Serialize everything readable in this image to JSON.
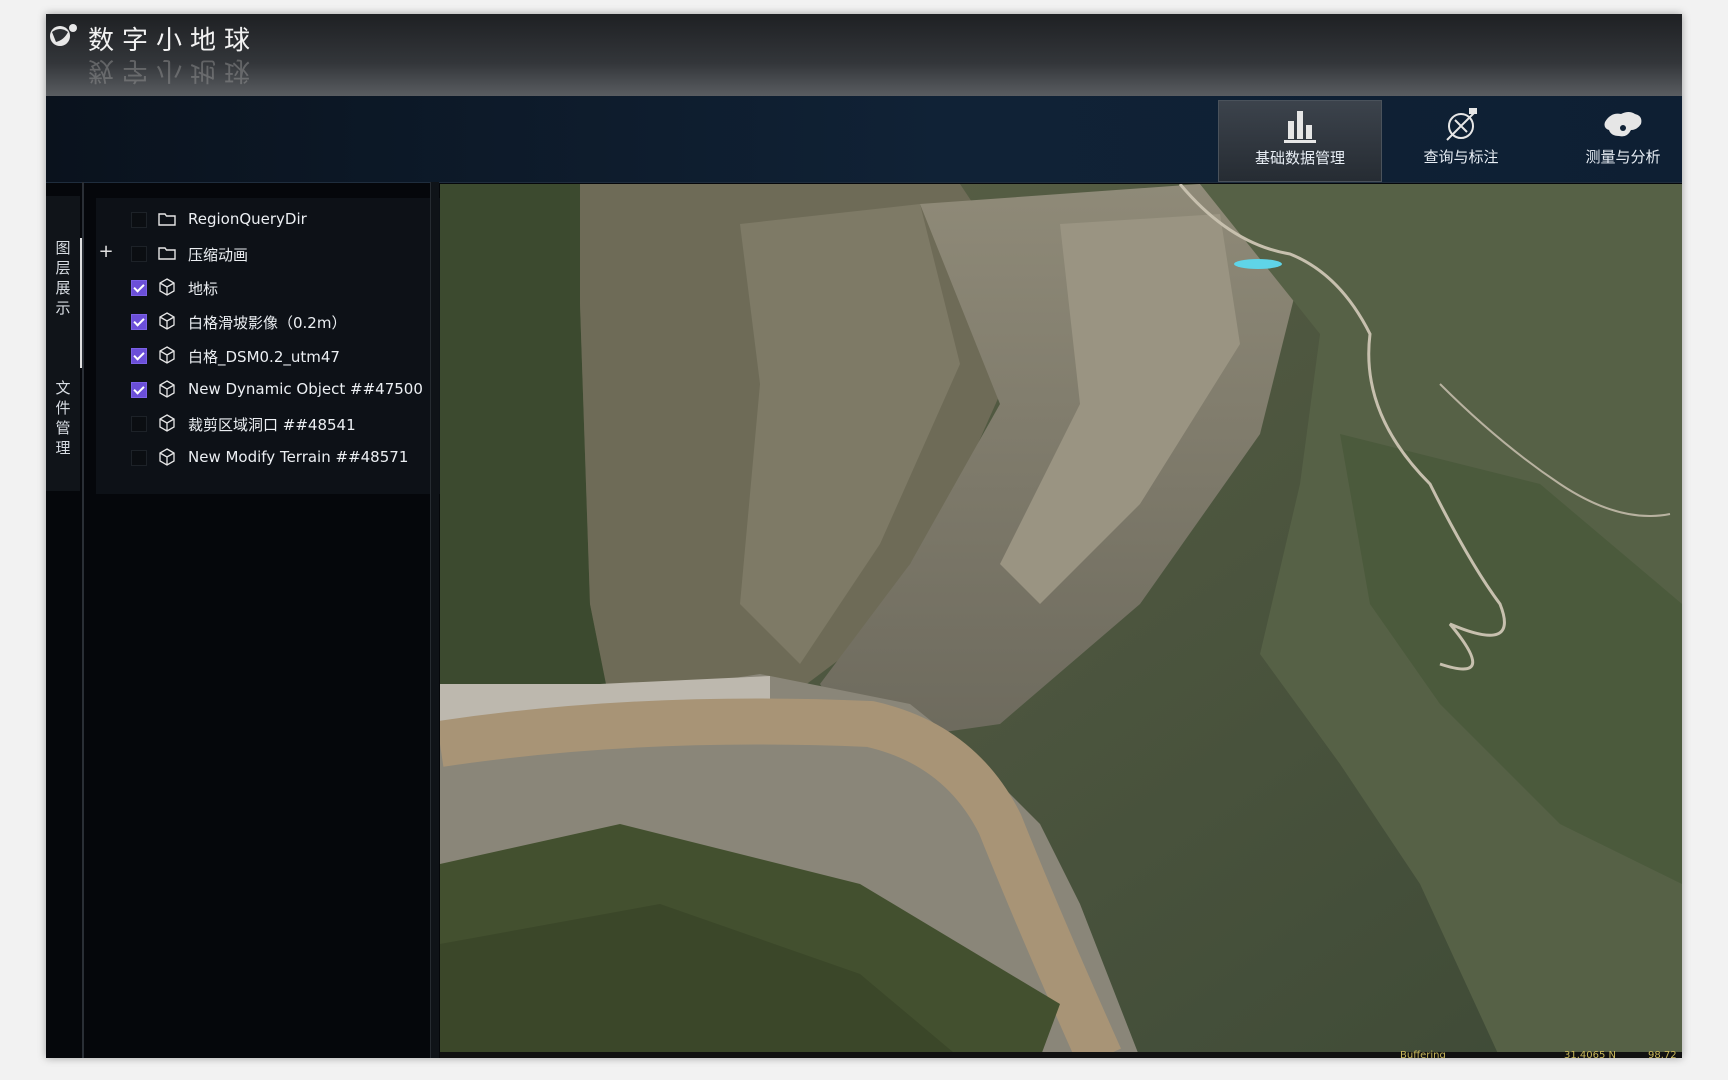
{
  "app": {
    "title": "数字小地球"
  },
  "toolbar": {
    "items": [
      {
        "label": "基础数据管理",
        "icon": "bar-chart-icon",
        "active": true
      },
      {
        "label": "查询与标注",
        "icon": "satellite-compass-icon",
        "active": false
      },
      {
        "label": "测量与分析",
        "icon": "china-map-icon",
        "active": false
      }
    ]
  },
  "side_tabs": [
    {
      "label": "图层展示",
      "active": true
    },
    {
      "label": "文件管理",
      "active": false
    }
  ],
  "layers": [
    {
      "label": "RegionQueryDir",
      "type": "folder",
      "checked": false,
      "expander": ""
    },
    {
      "label": "压缩动画",
      "type": "folder",
      "checked": false,
      "expander": "+"
    },
    {
      "label": "地标",
      "type": "object",
      "checked": true,
      "expander": ""
    },
    {
      "label": "白格滑坡影像（0.2m）",
      "type": "object",
      "checked": true,
      "expander": ""
    },
    {
      "label": "白格_DSM0.2_utm47",
      "type": "object",
      "checked": true,
      "expander": ""
    },
    {
      "label": "New Dynamic Object ##47500",
      "type": "object",
      "checked": true,
      "expander": ""
    },
    {
      "label": "裁剪区域洞口 ##48541",
      "type": "object",
      "checked": false,
      "expander": ""
    },
    {
      "label": "New Modify Terrain ##48571",
      "type": "object",
      "checked": false,
      "expander": ""
    }
  ],
  "status": {
    "buffering": "Buffering",
    "coords": "31.4065 N",
    "extra": "98.72"
  },
  "colors": {
    "checkbox_accent": "#6b4fd8",
    "toolbar_bg": "#102236",
    "river": "#a89476"
  }
}
